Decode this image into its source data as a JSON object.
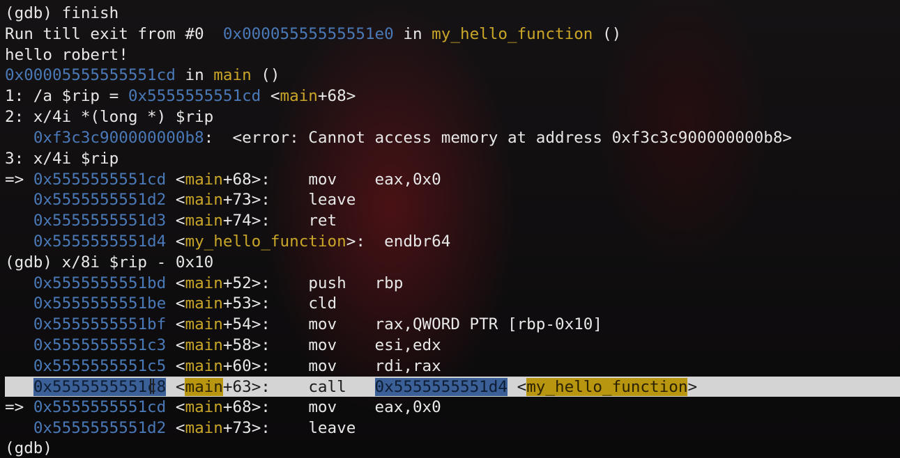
{
  "terminal": {
    "lines": {
      "l0": {
        "text": "(gdb) finish"
      },
      "l1": {
        "a": "Run till exit from #0  ",
        "addr": "0x00005555555551e0",
        "b": " in ",
        "fn": "my_hello_function",
        "c": " ()"
      },
      "l2": {
        "text": "hello robert!"
      },
      "l3": {
        "addr": "0x00005555555551cd",
        "b": " in ",
        "fn": "main",
        "c": " ()"
      },
      "l4": {
        "a": "1: /a $rip = ",
        "addr": "0x5555555551cd",
        "b": " <",
        "fn": "main",
        "c": "+68>"
      },
      "l5": {
        "text": "2: x/4i *(long *) $rip"
      },
      "l6": {
        "a": "   ",
        "addr": "0xf3c3c900000000b8",
        "b": ":  <error: Cannot access memory at address 0xf3c3c900000000b8>"
      },
      "l7": {
        "text": "3: x/4i $rip"
      },
      "l8": {
        "a": "=> ",
        "addr": "0x5555555551cd",
        "b": " <",
        "fn": "main",
        "c": "+68>:    mov    eax,0x0"
      },
      "l9": {
        "a": "   ",
        "addr": "0x5555555551d2",
        "b": " <",
        "fn": "main",
        "c": "+73>:    leave"
      },
      "l10": {
        "a": "   ",
        "addr": "0x5555555551d3",
        "b": " <",
        "fn": "main",
        "c": "+74>:    ret"
      },
      "l11": {
        "a": "   ",
        "addr": "0x5555555551d4",
        "b": " <",
        "fn": "my_hello_function",
        "c": ">:  endbr64"
      },
      "l12": {
        "text": "(gdb) x/8i $rip - 0x10"
      },
      "l13": {
        "a": "   ",
        "addr": "0x5555555551bd",
        "b": " <",
        "fn": "main",
        "c": "+52>:    push   rbp"
      },
      "l14": {
        "a": "   ",
        "addr": "0x5555555551be",
        "b": " <",
        "fn": "main",
        "c": "+53>:    cld"
      },
      "l15": {
        "a": "   ",
        "addr": "0x5555555551bf",
        "b": " <",
        "fn": "main",
        "c": "+54>:    mov    rax,QWORD PTR [rbp-0x10]"
      },
      "l16": {
        "a": "   ",
        "addr": "0x5555555551c3",
        "b": " <",
        "fn": "main",
        "c": "+58>:    mov    esi,edx"
      },
      "l17": {
        "a": "   ",
        "addr": "0x5555555551c5",
        "b": " <",
        "fn": "main",
        "c": "+60>:    mov    rdi,rax"
      },
      "l18": {
        "a": "   ",
        "addr": "0x5555555551c8",
        "b": " <",
        "fn": "main",
        "c": "+63>:    call   ",
        "addr2": "0x5555555551d4",
        "d": " <",
        "fn2": "my_hello_function",
        "e": ">"
      },
      "l19": {
        "a": "=> ",
        "addr": "0x5555555551cd",
        "b": " <",
        "fn": "main",
        "c": "+68>:    mov    eax,0x0"
      },
      "l20": {
        "a": "   ",
        "addr": "0x5555555551d2",
        "b": " <",
        "fn": "main",
        "c": "+73>:    leave"
      },
      "l21": {
        "text": "(gdb)"
      }
    },
    "colors": {
      "background": "#0d0b0c",
      "text": "#e8e8e8",
      "address": "#4a79b8",
      "function": "#c9a628",
      "selection": "#d4d4d4"
    }
  }
}
